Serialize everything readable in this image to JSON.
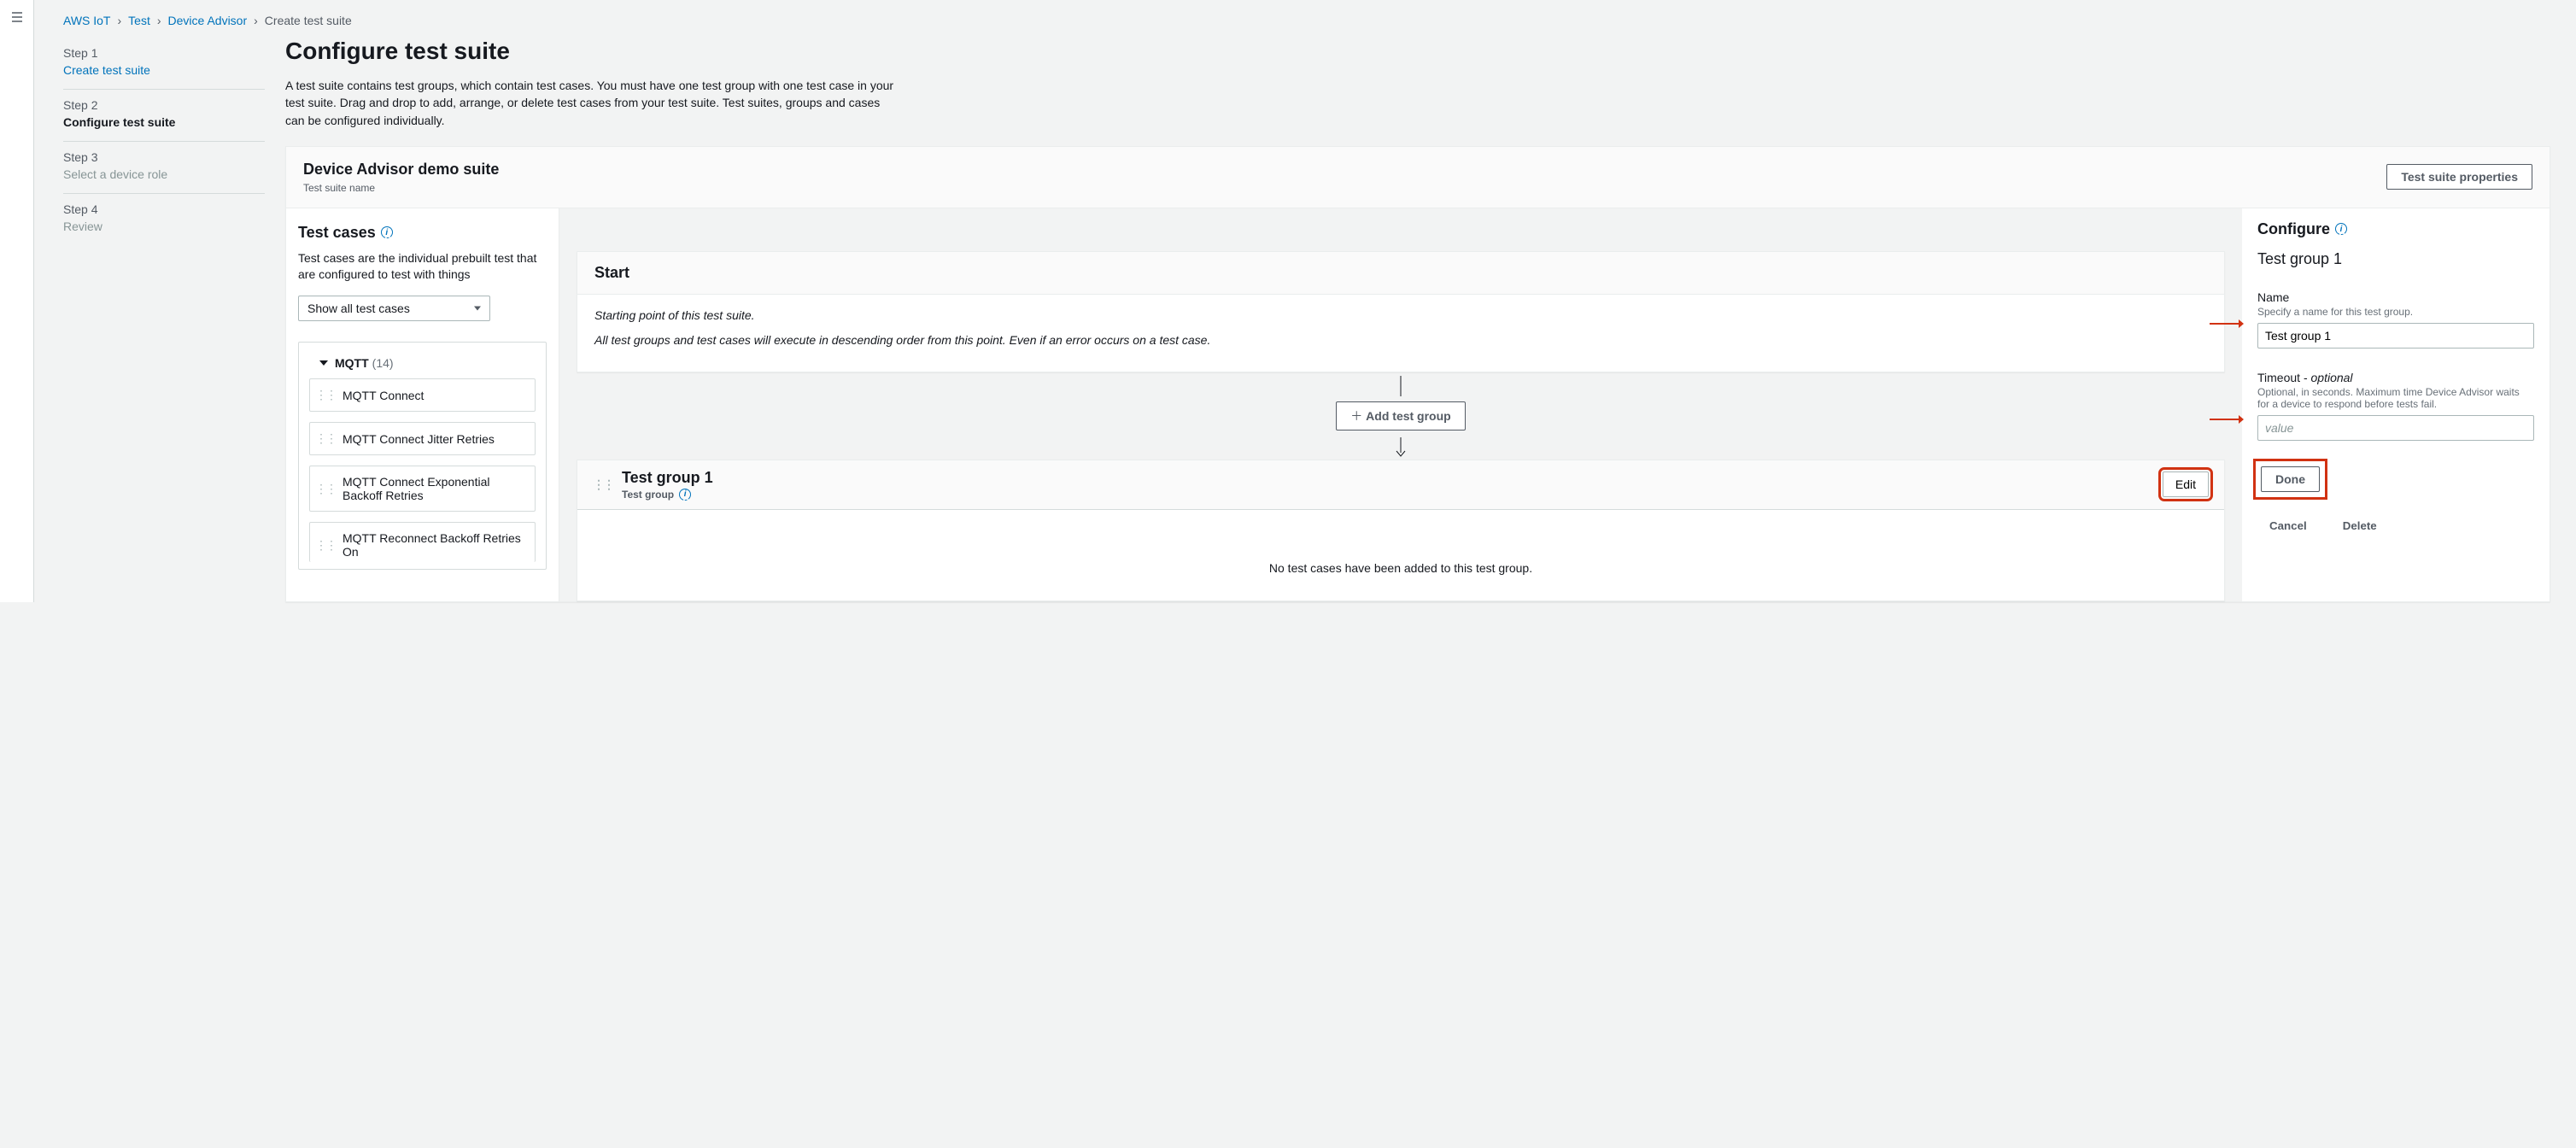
{
  "breadcrumb": {
    "items": [
      "AWS IoT",
      "Test",
      "Device Advisor"
    ],
    "current": "Create test suite"
  },
  "wizard": {
    "steps": [
      {
        "label": "Step 1",
        "title": "Create test suite",
        "state": "link"
      },
      {
        "label": "Step 2",
        "title": "Configure test suite",
        "state": "active"
      },
      {
        "label": "Step 3",
        "title": "Select a device role",
        "state": "disabled"
      },
      {
        "label": "Step 4",
        "title": "Review",
        "state": "disabled"
      }
    ]
  },
  "page": {
    "title": "Configure test suite",
    "description": "A test suite contains test groups, which contain test cases. You must have one test group with one test case in your test suite. Drag and drop to add, arrange, or delete test cases from your test suite. Test suites, groups and cases can be configured individually."
  },
  "suite": {
    "name": "Device Advisor demo suite",
    "name_label": "Test suite name",
    "properties_btn": "Test suite properties"
  },
  "testcases": {
    "title": "Test cases",
    "desc": "Test cases are the individual prebuilt test that are configured to test with things",
    "filter": "Show all test cases",
    "group_name": "MQTT",
    "group_count": "(14)",
    "items": [
      "MQTT Connect",
      "MQTT Connect Jitter Retries",
      "MQTT Connect Exponential Backoff Retries",
      "MQTT Reconnect Backoff Retries On"
    ]
  },
  "flow": {
    "start_title": "Start",
    "start_line1": "Starting point of this test suite.",
    "start_line2": "All test groups and test cases will execute in descending order from this point. Even if an error occurs on a test case.",
    "add_group_btn": "Add test group",
    "group_title": "Test group 1",
    "group_sub": "Test group",
    "edit_btn": "Edit",
    "empty_msg": "No test cases have been added to this test group."
  },
  "configure": {
    "title": "Configure",
    "subject": "Test group 1",
    "name_label": "Name",
    "name_hint": "Specify a name for this test group.",
    "name_value": "Test group 1",
    "timeout_label": "Timeout - ",
    "timeout_opt": "optional",
    "timeout_hint": "Optional, in seconds. Maximum time Device Advisor waits for a device to respond before tests fail.",
    "timeout_placeholder": "value",
    "done_btn": "Done",
    "cancel_btn": "Cancel",
    "delete_btn": "Delete"
  }
}
